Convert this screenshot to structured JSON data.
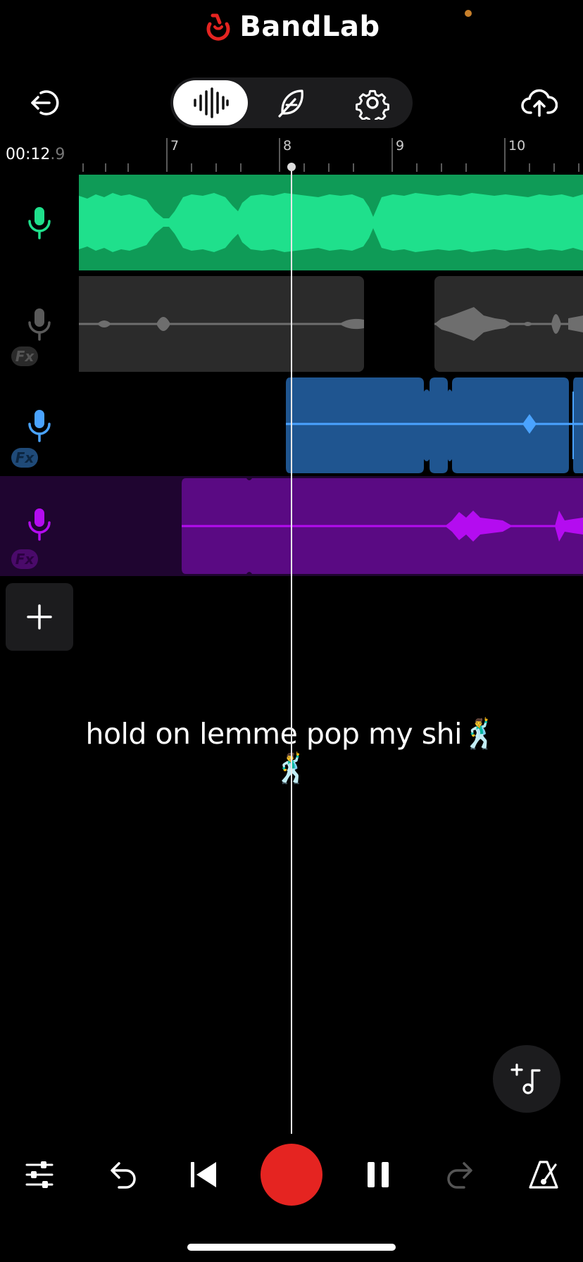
{
  "header": {
    "brand": "BandLab"
  },
  "toolbar": {
    "modes": [
      {
        "id": "waveform",
        "icon": "waveform-icon",
        "active": true
      },
      {
        "id": "feather",
        "icon": "feather-icon",
        "active": false
      },
      {
        "id": "settings",
        "icon": "gear-icon",
        "active": false
      }
    ]
  },
  "timeline": {
    "time_main": "00:12",
    "time_fraction": ".9",
    "ruler_labels": [
      "7",
      "8",
      "9",
      "10"
    ]
  },
  "tracks": [
    {
      "name": "track-1",
      "color": "#1fe08c",
      "clip_color": "#0f9b57",
      "muted": false,
      "fx": false
    },
    {
      "name": "track-2",
      "color": "#8a8a8a",
      "clip_color": "#2b2b2b",
      "muted": true,
      "fx": true
    },
    {
      "name": "track-3",
      "color": "#4aa3ff",
      "clip_color": "#1f5590",
      "muted": false,
      "fx": true
    },
    {
      "name": "track-4",
      "color": "#b40cf0",
      "clip_color": "#5a0a83",
      "muted": false,
      "fx": true
    }
  ],
  "fx_label": "Fx",
  "caption": {
    "text": "hold on lemme pop my shi",
    "emoji": "🕺"
  },
  "colors": {
    "record": "#e52421",
    "brand_red": "#e52421"
  }
}
